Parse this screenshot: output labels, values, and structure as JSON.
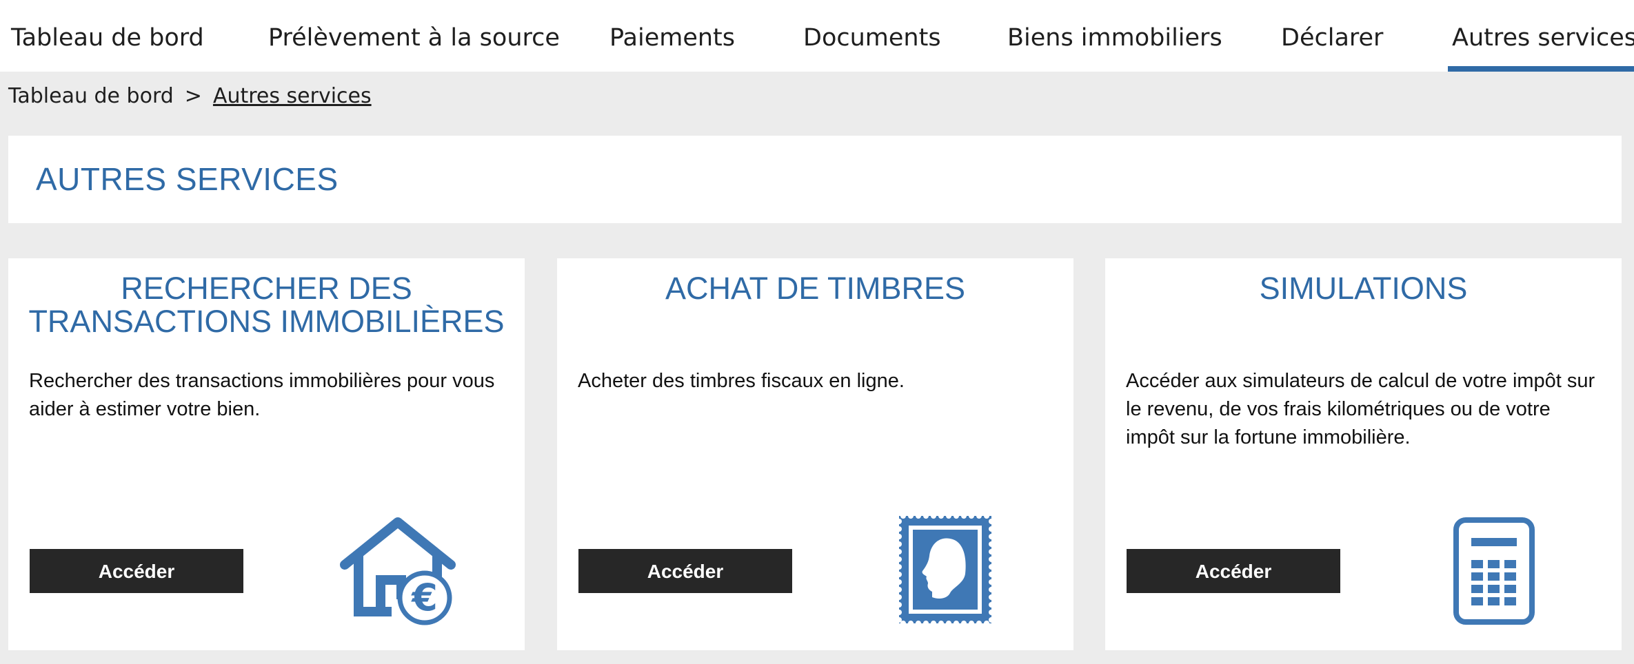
{
  "nav": {
    "tabs": [
      {
        "label": "Tableau de bord"
      },
      {
        "label": "Prélèvement à la source"
      },
      {
        "label": "Paiements"
      },
      {
        "label": "Documents"
      },
      {
        "label": "Biens immobiliers"
      },
      {
        "label": "Déclarer"
      },
      {
        "label": "Autres services",
        "active": true
      }
    ]
  },
  "breadcrumb": {
    "root": "Tableau de bord",
    "separator": ">",
    "current": "Autres services"
  },
  "page": {
    "title": "AUTRES SERVICES"
  },
  "cards": [
    {
      "title": "RECHERCHER DES TRANSACTIONS IMMOBILIÈRES",
      "description": "Rechercher des transactions immobilières pour vous aider à estimer votre bien.",
      "button": "Accéder",
      "icon": "house-euro-icon"
    },
    {
      "title": "ACHAT DE TIMBRES",
      "description": "Acheter des timbres fiscaux en ligne.",
      "button": "Accéder",
      "icon": "stamp-icon"
    },
    {
      "title": "SIMULATIONS",
      "description": "Accéder aux simulateurs de calcul de votre impôt sur le revenu, de vos frais kilométriques ou de votre impôt sur la fortune immobilière.",
      "button": "Accéder",
      "icon": "calculator-icon"
    }
  ],
  "colors": {
    "accent": "#2f6aa6",
    "icon": "#3f78b5",
    "button": "#272727",
    "background": "#ececec"
  }
}
